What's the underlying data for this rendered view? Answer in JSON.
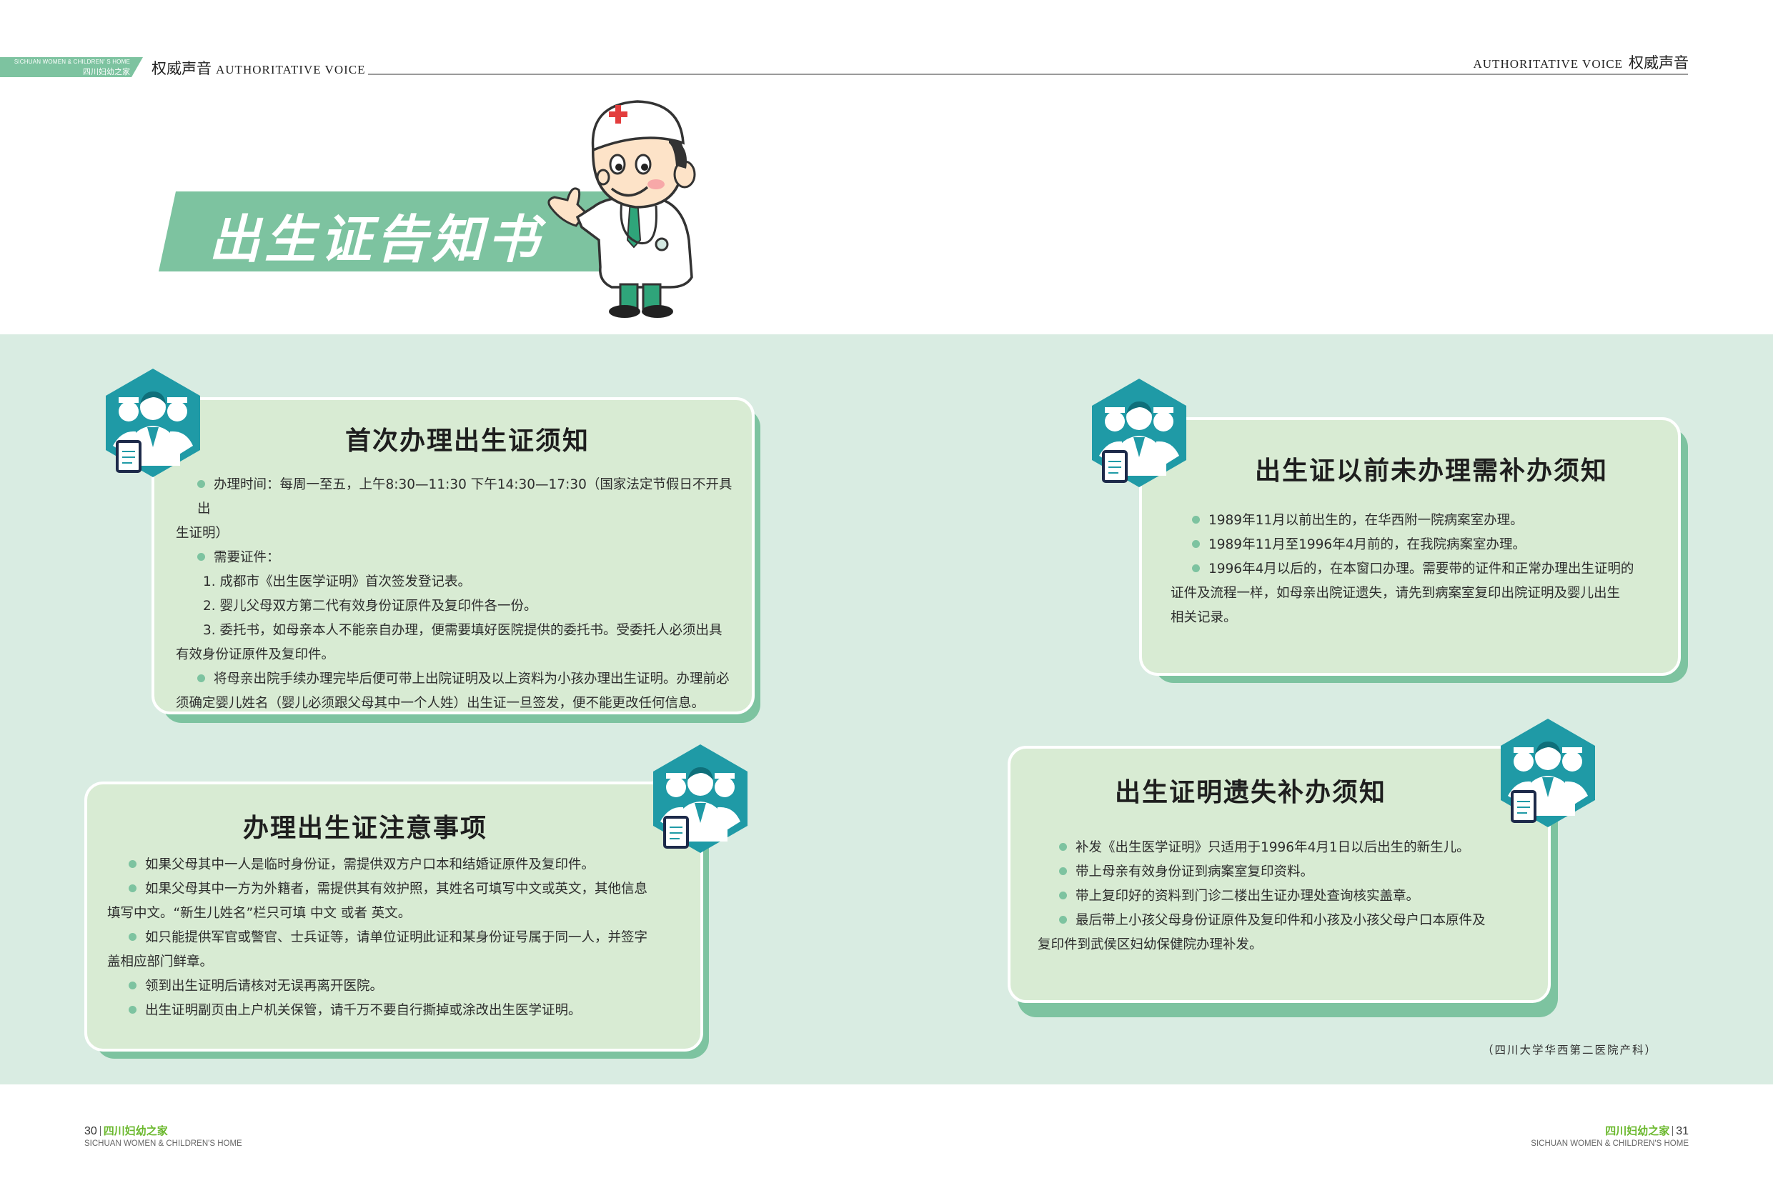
{
  "header": {
    "left_tag_en": "SICHUAN WOMEN & CHILDREN' S HOME",
    "left_tag_cn": "四川妇幼之家",
    "left_title_cn": "权威声音",
    "left_title_en": "AUTHORITATIVE VOICE",
    "right_title_en": "AUTHORITATIVE VOICE",
    "right_title_cn": "权威声音"
  },
  "banner": {
    "title": "出生证告知书"
  },
  "cards": {
    "first": {
      "title": "首次办理出生证须知",
      "lines": [
        "办理时间：每周一至五，上午8:30—11:30 下午14:30—17:30（国家法定节假日不开具出",
        "生证明）",
        "需要证件：",
        "1. 成都市《出生医学证明》首次签发登记表。",
        "2. 婴儿父母双方第二代有效身份证原件及复印件各一份。",
        "3. 委托书，如母亲本人不能亲自办理，便需要填好医院提供的委托书。受委托人必须出具",
        "有效身份证原件及复印件。",
        "将母亲出院手续办理完毕后便可带上出院证明及以上资料为小孩办理出生证明。办理前必",
        "须确定婴儿姓名（婴儿必须跟父母其中一个人姓）出生证一旦签发，便不能更改任何信息。"
      ]
    },
    "notes": {
      "title": "办理出生证注意事项",
      "lines": [
        "如果父母其中一人是临时身份证，需提供双方户口本和结婚证原件及复印件。",
        "如果父母其中一方为外籍者，需提供其有效护照，其姓名可填写中文或英文，其他信息",
        "填写中文。“新生儿姓名”栏只可填 中文 或者 英文。",
        "如只能提供军官或警官、士兵证等，请单位证明此证和某身份证号属于同一人，并签字",
        "盖相应部门鲜章。",
        "领到出生证明后请核对无误再离开医院。",
        "出生证明副页由上户机关保管，请千万不要自行撕掉或涂改出生医学证明。"
      ]
    },
    "before": {
      "title": "出生证以前未办理需补办须知",
      "lines": [
        "1989年11月以前出生的，在华西附一院病案室办理。",
        "1989年11月至1996年4月前的，在我院病案室办理。",
        "1996年4月以后的，在本窗口办理。需要带的证件和正常办理出生证明的",
        "证件及流程一样，如母亲出院证遗失，请先到病案室复印出院证明及婴儿出生",
        "相关记录。"
      ]
    },
    "lost": {
      "title": "出生证明遗失补办须知",
      "lines": [
        "补发《出生医学证明》只适用于1996年4月1日以后出生的新生儿。",
        "带上母亲有效身份证到病案室复印资料。",
        "带上复印好的资料到门诊二楼出生证办理处查询核实盖章。",
        "最后带上小孩父母身份证原件及复印件和小孩及小孩父母户口本原件及",
        "复印件到武侯区妇幼保健院办理补发。"
      ]
    }
  },
  "credit": "（四川大学华西第二医院产科）",
  "footer": {
    "left_page": "30",
    "left_mag": "四川妇幼之家",
    "left_en": "SICHUAN WOMEN & CHILDREN'S HOME",
    "right_mag": "四川妇幼之家",
    "right_page": "31",
    "right_en": "SICHUAN WOMEN & CHILDREN'S HOME"
  },
  "colors": {
    "accent_green": "#7dc3a0",
    "card_fill": "#d8ebd3",
    "panel_bg": "#d9ece2",
    "hex_teal": "#1f9aa6",
    "footer_green": "#6ab82c"
  },
  "icons": [
    "medical-staff-icon",
    "doctor-mascot-icon"
  ]
}
